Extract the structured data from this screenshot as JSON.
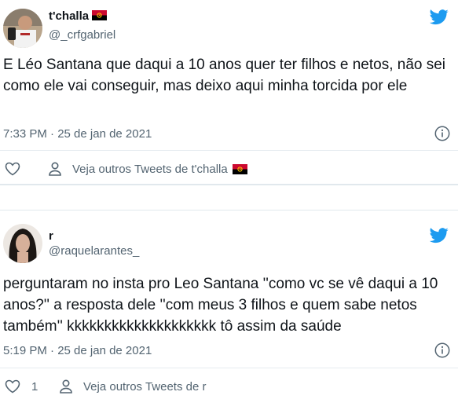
{
  "tweets": [
    {
      "display_name": "t'challa",
      "handle": "@_crfgabriel",
      "text": "E Léo Santana que daqui a 10 anos quer ter filhos e netos, não sei como ele vai conseguir, mas deixo aqui minha torcida por ele",
      "meta": "7:33 PM · 25 de jan de 2021",
      "like_count": "",
      "see_more": "Veja outros Tweets de t'challa",
      "flag_icon": "angola-flag-icon"
    },
    {
      "display_name": "r",
      "handle": "@raquelarantes_",
      "text": "perguntaram no insta pro Leo Santana ''como vc se vê daqui a 10 anos?'' a resposta dele ''com meus 3 filhos e quem sabe netos também'' kkkkkkkkkkkkkkkkkkkk tô assim da saúde",
      "meta": "5:19 PM · 25 de jan de 2021",
      "like_count": "1",
      "see_more": "Veja outros Tweets de r"
    }
  ],
  "colors": {
    "twitter_blue": "#1d9bf0",
    "text_primary": "#0f1419",
    "text_secondary": "#536471",
    "divider": "#e6ecf0"
  },
  "icons": [
    "twitter-bird-icon",
    "info-icon",
    "heart-icon",
    "person-icon",
    "angola-flag-icon"
  ]
}
